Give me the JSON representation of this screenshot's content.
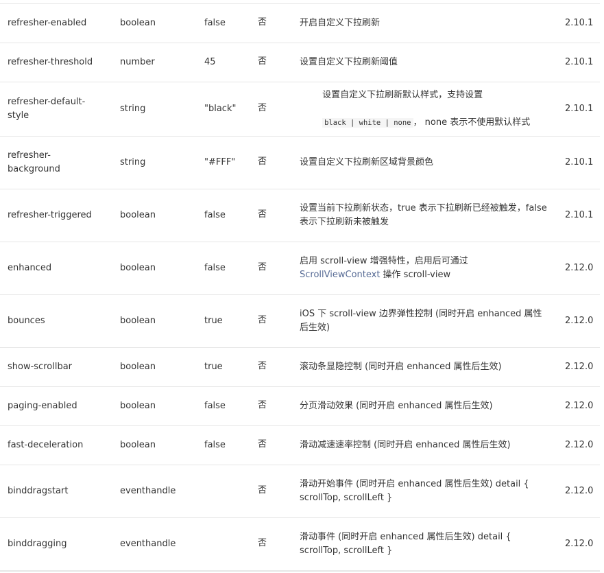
{
  "table": {
    "rows": [
      {
        "name": "refresher-enabled",
        "type": "boolean",
        "default": "false",
        "required": "否",
        "desc": "开启自定义下拉刷新",
        "version": "2.10.1"
      },
      {
        "name": "refresher-threshold",
        "type": "number",
        "default": "45",
        "required": "否",
        "desc": "设置自定义下拉刷新阈值",
        "version": "2.10.1"
      },
      {
        "name": "refresher-default-style",
        "type": "string",
        "default": "\"black\"",
        "required": "否",
        "desc_line1": "设置自定义下拉刷新默认样式，支持设置",
        "desc_code": "black | white | none",
        "desc_line2_suffix": "， none 表示不使用默认样式",
        "version": "2.10.1"
      },
      {
        "name": "refresher-background",
        "type": "string",
        "default": "\"#FFF\"",
        "required": "否",
        "desc": "设置自定义下拉刷新区域背景颜色",
        "version": "2.10.1"
      },
      {
        "name": "refresher-triggered",
        "type": "boolean",
        "default": "false",
        "required": "否",
        "desc": "设置当前下拉刷新状态，true 表示下拉刷新已经被触发，false 表示下拉刷新未被触发",
        "version": "2.10.1"
      },
      {
        "name": "enhanced",
        "type": "boolean",
        "default": "false",
        "required": "否",
        "desc_before_link": "启用 scroll-view 增强特性，启用后可通过 ",
        "desc_link": "ScrollViewContext",
        "desc_after_link": " 操作 scroll-view",
        "version": "2.12.0"
      },
      {
        "name": "bounces",
        "type": "boolean",
        "default": "true",
        "required": "否",
        "desc": "iOS 下 scroll-view 边界弹性控制 (同时开启 enhanced 属性后生效)",
        "version": "2.12.0"
      },
      {
        "name": "show-scrollbar",
        "type": "boolean",
        "default": "true",
        "required": "否",
        "desc": "滚动条显隐控制 (同时开启 enhanced 属性后生效)",
        "version": "2.12.0"
      },
      {
        "name": "paging-enabled",
        "type": "boolean",
        "default": "false",
        "required": "否",
        "desc": "分页滑动效果 (同时开启 enhanced 属性后生效)",
        "version": "2.12.0"
      },
      {
        "name": "fast-deceleration",
        "type": "boolean",
        "default": "false",
        "required": "否",
        "desc": "滑动减速速率控制 (同时开启 enhanced 属性后生效)",
        "version": "2.12.0"
      },
      {
        "name": "binddragstart",
        "type": "eventhandle",
        "default": "",
        "required": "否",
        "desc": "滑动开始事件 (同时开启 enhanced 属性后生效) detail { scrollTop, scrollLeft }",
        "version": "2.12.0"
      },
      {
        "name": "binddragging",
        "type": "eventhandle",
        "default": "",
        "required": "否",
        "desc": "滑动事件 (同时开启 enhanced 属性后生效) detail { scrollTop, scrollLeft }",
        "version": "2.12.0"
      }
    ]
  },
  "colors": {
    "text": "#333333",
    "link": "#576b95",
    "border": "#e6e6e6"
  }
}
